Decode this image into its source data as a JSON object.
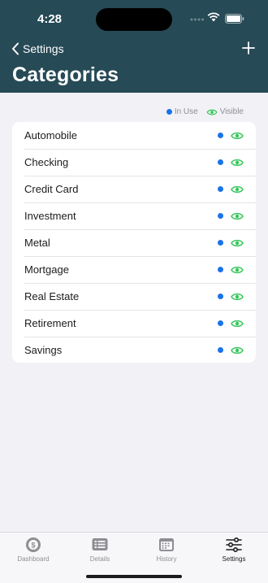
{
  "status_bar": {
    "time": "4:28"
  },
  "nav": {
    "back_label": "Settings",
    "title": "Categories"
  },
  "legend": {
    "in_use_label": "In Use",
    "visible_label": "Visible"
  },
  "categories": [
    {
      "label": "Automobile"
    },
    {
      "label": "Checking"
    },
    {
      "label": "Credit Card"
    },
    {
      "label": "Investment"
    },
    {
      "label": "Metal"
    },
    {
      "label": "Mortgage"
    },
    {
      "label": "Real Estate"
    },
    {
      "label": "Retirement"
    },
    {
      "label": "Savings"
    }
  ],
  "tabs": [
    {
      "label": "Dashboard",
      "icon": "dollar-circle-icon"
    },
    {
      "label": "Details",
      "icon": "list-icon"
    },
    {
      "label": "History",
      "icon": "calendar-icon"
    },
    {
      "label": "Settings",
      "icon": "sliders-icon",
      "selected": true
    }
  ],
  "colors": {
    "header_bg": "#264a56",
    "in_use": "#1a73e8",
    "visible": "#34c759",
    "tab_inactive": "#8e8e93",
    "tab_active": "#1c1c1e"
  }
}
